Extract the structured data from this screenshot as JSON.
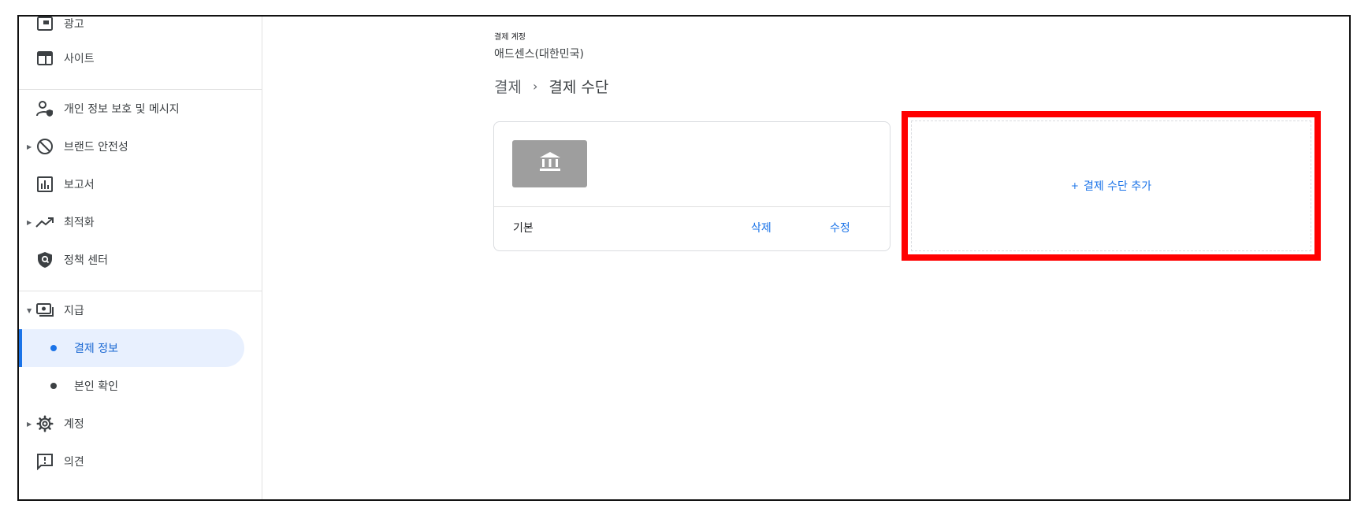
{
  "sidebar": {
    "items": [
      {
        "label": "광고"
      },
      {
        "label": "사이트"
      },
      {
        "label": "개인 정보 보호 및 메시지"
      },
      {
        "label": "브랜드 안전성"
      },
      {
        "label": "보고서"
      },
      {
        "label": "최적화"
      },
      {
        "label": "정책 센터"
      },
      {
        "label": "지급"
      },
      {
        "label": "결제 정보"
      },
      {
        "label": "본인 확인"
      },
      {
        "label": "계정"
      },
      {
        "label": "의견"
      }
    ]
  },
  "main": {
    "account_label": "결제 계정",
    "account_name": "애드센스(대한민국)",
    "breadcrumb": {
      "parent": "결제",
      "separator": "›",
      "current": "결제 수단"
    },
    "payment_card": {
      "default_label": "기본",
      "delete_label": "삭제",
      "edit_label": "수정"
    },
    "add_payment": {
      "plus": "+",
      "label": "결제 수단 추가"
    }
  },
  "colors": {
    "accent": "#1a73e8",
    "active_bg": "#e8f0fe",
    "highlight_box": "#ff0000",
    "bank_tile": "#9e9e9e"
  }
}
